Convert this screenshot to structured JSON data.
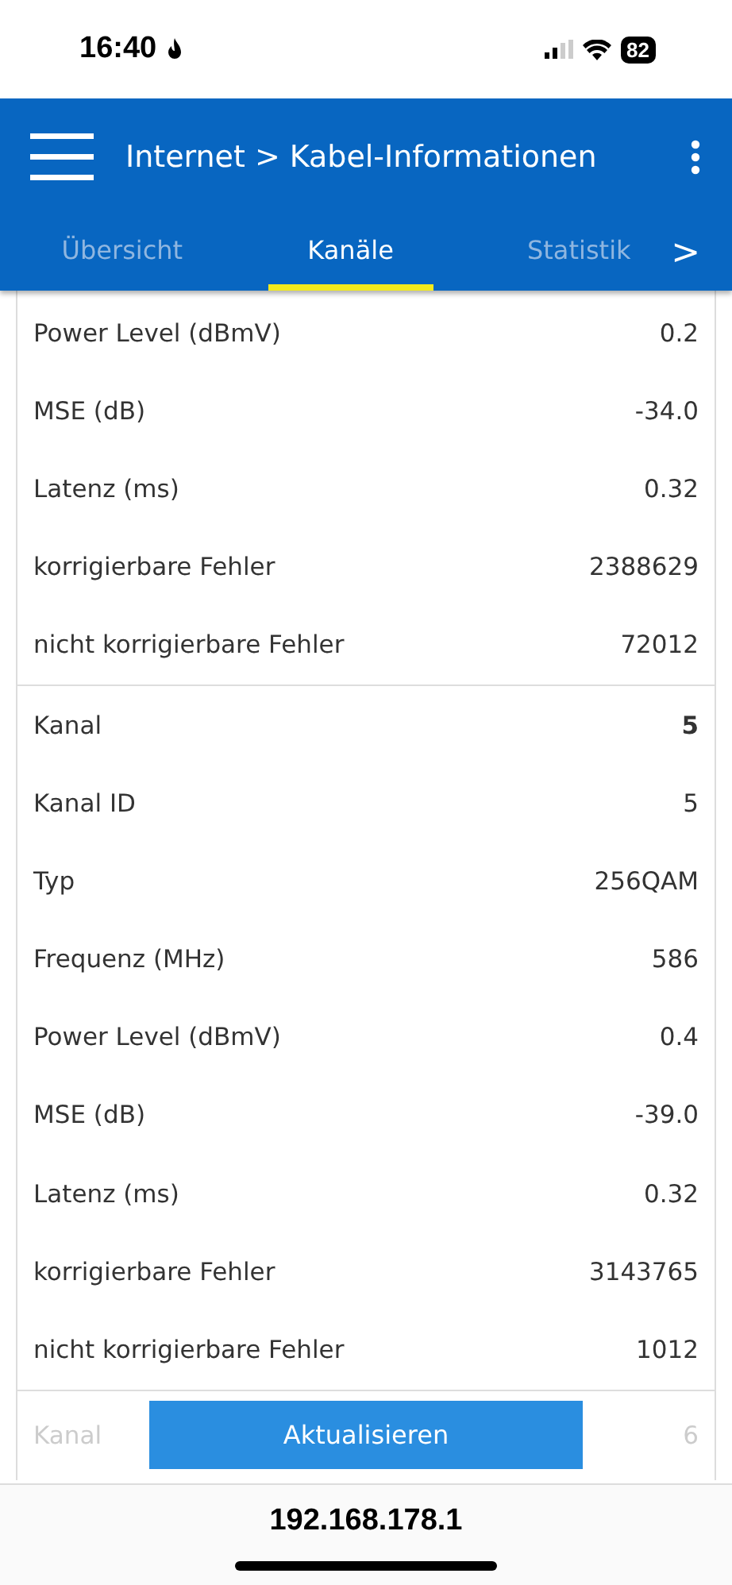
{
  "status_bar": {
    "time": "16:40",
    "battery": "82"
  },
  "header": {
    "breadcrumb_parent": "Internet",
    "separator": ">",
    "title": "Kabel-Informationen"
  },
  "tabs": [
    {
      "label": "Übersicht",
      "selected": false
    },
    {
      "label": "Kanäle",
      "selected": true
    },
    {
      "label": "Statistik",
      "selected": false
    }
  ],
  "tabs_more": ">",
  "channel_groups": [
    {
      "rows": [
        {
          "label": "Power Level (dBmV)",
          "value": "0.2",
          "kind": "field"
        },
        {
          "label": "MSE (dB)",
          "value": "-34.0",
          "kind": "field"
        },
        {
          "label": "Latenz (ms)",
          "value": "0.32",
          "kind": "field"
        },
        {
          "label": "korrigierbare Fehler",
          "value": "2388629",
          "kind": "field"
        },
        {
          "label": "nicht korrigierbare Fehler",
          "value": "72012",
          "kind": "field"
        }
      ]
    },
    {
      "rows": [
        {
          "label": "Kanal",
          "value": "5",
          "kind": "channel"
        },
        {
          "label": "Kanal ID",
          "value": "5",
          "kind": "field"
        },
        {
          "label": "Typ",
          "value": "256QAM",
          "kind": "field"
        },
        {
          "label": "Frequenz (MHz)",
          "value": "586",
          "kind": "field"
        },
        {
          "label": "Power Level (dBmV)",
          "value": "0.4",
          "kind": "field"
        },
        {
          "label": "MSE (dB)",
          "value": "-39.0",
          "kind": "field"
        },
        {
          "label": "Latenz (ms)",
          "value": "0.32",
          "kind": "field"
        },
        {
          "label": "korrigierbare Fehler",
          "value": "3143765",
          "kind": "field"
        },
        {
          "label": "nicht korrigierbare Fehler",
          "value": "1012",
          "kind": "field"
        }
      ]
    }
  ],
  "faded_row": {
    "label": "Kanal",
    "value": "6"
  },
  "refresh_button": "Aktualisieren",
  "address": "192.168.178.1"
}
